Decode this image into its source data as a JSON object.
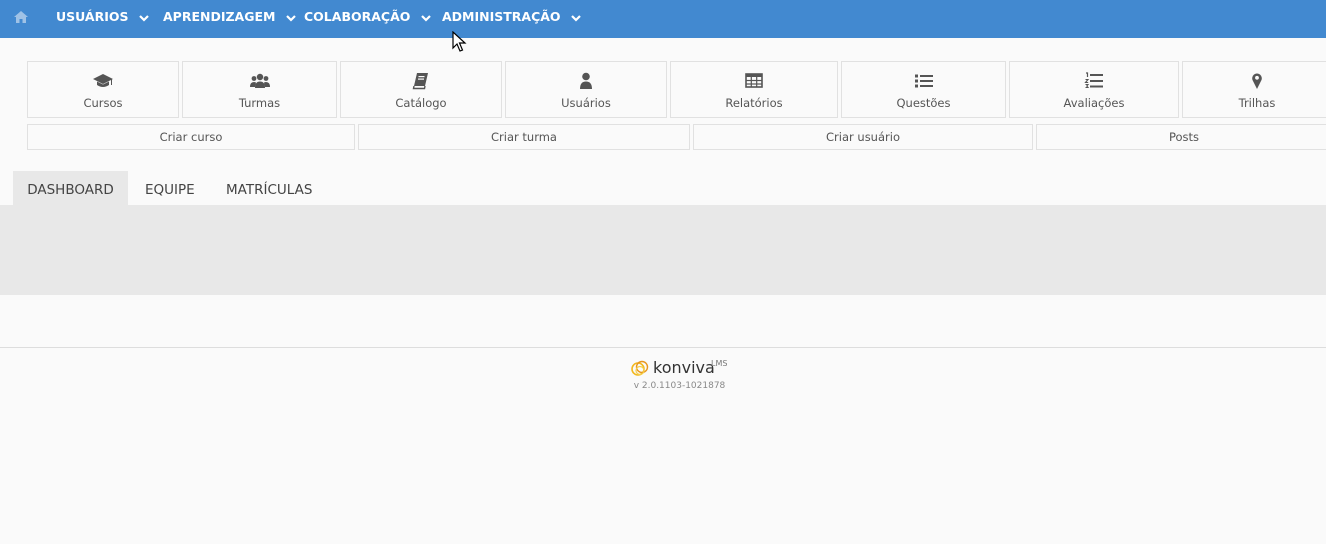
{
  "colors": {
    "topbar": "#4289d0",
    "tab_panel": "#e8e8e8",
    "text": "#555555"
  },
  "nav": {
    "home_icon": "home-icon",
    "menus": [
      {
        "label": "USUÁRIOS"
      },
      {
        "label": "APRENDIZAGEM"
      },
      {
        "label": "COLABORAÇÃO"
      },
      {
        "label": "ADMINISTRAÇÃO"
      }
    ]
  },
  "shortcuts": [
    {
      "label": "Cursos",
      "icon": "graduation-cap-icon"
    },
    {
      "label": "Turmas",
      "icon": "group-icon"
    },
    {
      "label": "Catálogo",
      "icon": "book-icon"
    },
    {
      "label": "Usuários",
      "icon": "user-icon"
    },
    {
      "label": "Relatórios",
      "icon": "table-icon"
    },
    {
      "label": "Questões",
      "icon": "list-icon"
    },
    {
      "label": "Avaliações",
      "icon": "ordered-list-icon"
    },
    {
      "label": "Trilhas",
      "icon": "map-marker-icon"
    }
  ],
  "actions": [
    {
      "label": "Criar curso"
    },
    {
      "label": "Criar turma"
    },
    {
      "label": "Criar usuário"
    },
    {
      "label": "Posts"
    }
  ],
  "tabs": [
    {
      "label": "DASHBOARD",
      "active": true
    },
    {
      "label": "EQUIPE",
      "active": false
    },
    {
      "label": "MATRÍCULAS",
      "active": false
    }
  ],
  "footer": {
    "brand": "konviva",
    "brand_sup": "LMS",
    "version": "v 2.0.1103-1021878"
  }
}
